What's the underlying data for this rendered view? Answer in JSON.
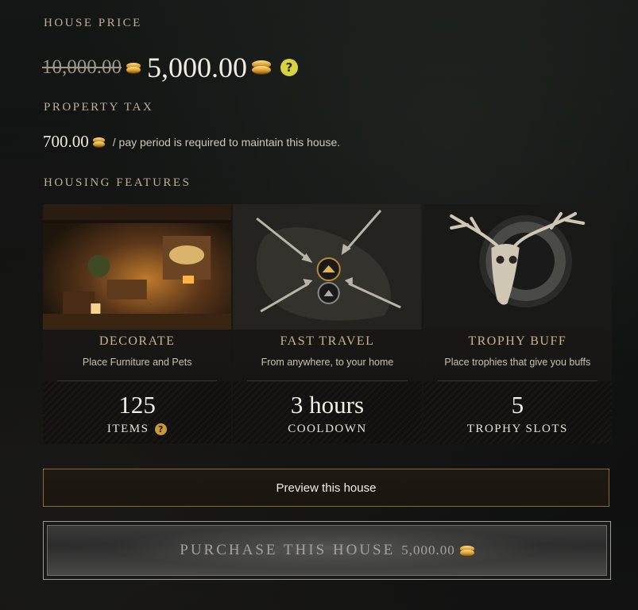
{
  "house_price": {
    "label": "HOUSE PRICE",
    "original_price": "10,000.00",
    "current_price": "5,000.00",
    "currency_icon": "gold-coin-icon",
    "help_icon": "question-icon"
  },
  "property_tax": {
    "label": "PROPERTY TAX",
    "amount": "700.00",
    "note": "/ pay period is required to maintain this house."
  },
  "housing_features": {
    "label": "HOUSING FEATURES",
    "items": [
      {
        "title": "DECORATE",
        "subtitle": "Place Furniture and Pets",
        "stat_value": "125",
        "stat_unit": "ITEMS",
        "art_icon": "furnished-room-image"
      },
      {
        "title": "FAST TRAVEL",
        "subtitle": "From anywhere, to your home",
        "stat_value": "3 hours",
        "stat_unit": "COOLDOWN",
        "art_icon": "map-arrows-image"
      },
      {
        "title": "TROPHY BUFF",
        "subtitle": "Place trophies that give you buffs",
        "stat_value": "5",
        "stat_unit": "TROPHY SLOTS",
        "art_icon": "deer-skull-trophy-image"
      }
    ]
  },
  "actions": {
    "preview_label": "Preview this house",
    "purchase_label": "PURCHASE THIS HOUSE",
    "purchase_price": "5,000.00"
  },
  "colors": {
    "accent_gold": "#c7b48f",
    "help_yellow": "#d8d241",
    "coin_gold": "#d69b2c",
    "preview_border": "#8a6a30"
  }
}
